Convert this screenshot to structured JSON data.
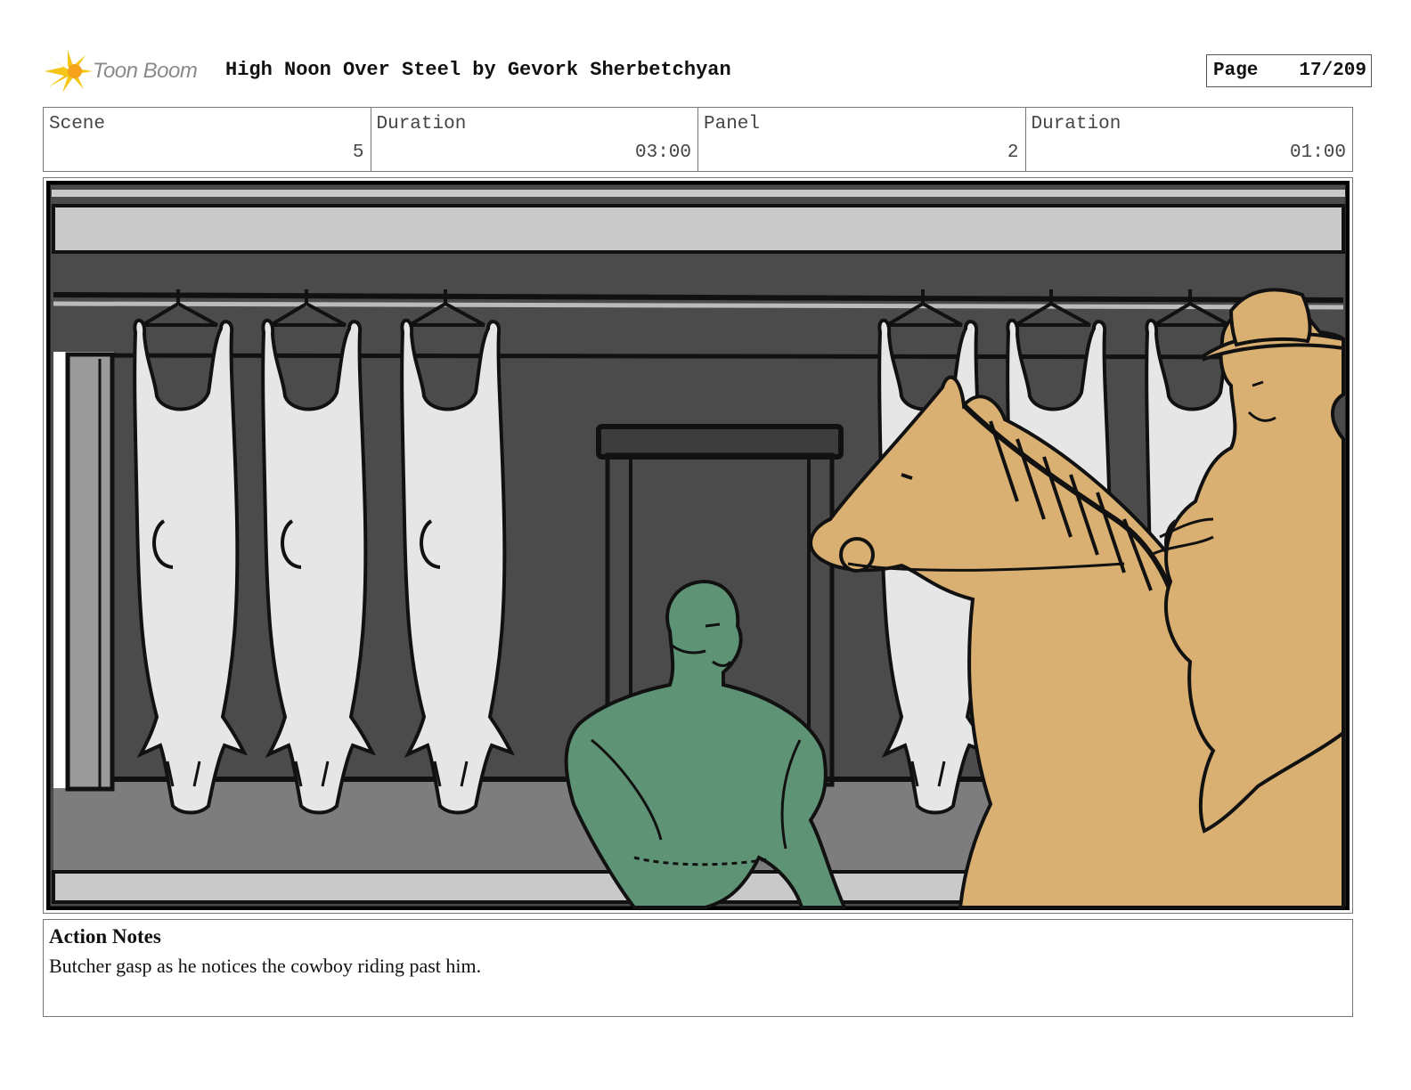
{
  "header": {
    "logo_text": "Toon Boom",
    "title": "High Noon Over Steel by Gevork Sherbetchyan",
    "page_label": "Page",
    "page_number": "17/209"
  },
  "info": {
    "scene_label": "Scene",
    "scene_value": "5",
    "scene_duration_label": "Duration",
    "scene_duration_value": "03:00",
    "panel_label": "Panel",
    "panel_value": "2",
    "panel_duration_label": "Duration",
    "panel_duration_value": "01:00"
  },
  "notes": {
    "title": "Action Notes",
    "text": "Butcher gasp as he notices the cowboy riding past him."
  },
  "colors": {
    "logo_yellow": "#f5c518",
    "butcher_green": "#5e9475",
    "horse_tan": "#d9b071",
    "carcass_gray": "#e6e6e6",
    "wall_dark": "#4b4b4b"
  }
}
